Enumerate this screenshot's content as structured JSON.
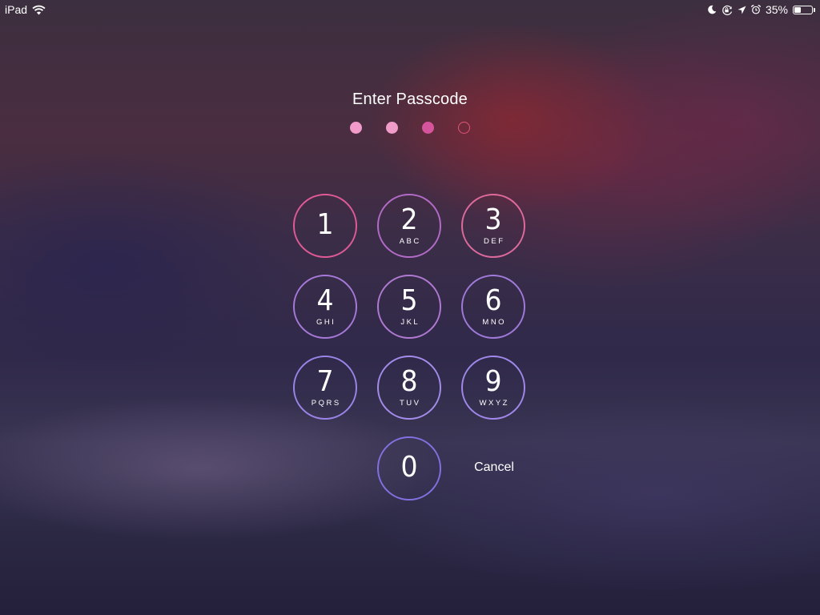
{
  "status_bar": {
    "device": "iPad",
    "battery_text": "35%",
    "battery_level": 0.35,
    "icons": [
      "wifi-icon",
      "moon-icon",
      "rotation-lock-icon",
      "location-arrow-icon",
      "alarm-icon",
      "battery-icon"
    ]
  },
  "passcode": {
    "title": "Enter Passcode",
    "digits_entered": 3,
    "digits_total": 4
  },
  "keypad": {
    "keys": [
      {
        "digit": "1",
        "letters": ""
      },
      {
        "digit": "2",
        "letters": "ABC"
      },
      {
        "digit": "3",
        "letters": "DEF"
      },
      {
        "digit": "4",
        "letters": "GHI"
      },
      {
        "digit": "5",
        "letters": "JKL"
      },
      {
        "digit": "6",
        "letters": "MNO"
      },
      {
        "digit": "7",
        "letters": "PQRS"
      },
      {
        "digit": "8",
        "letters": "TUV"
      },
      {
        "digit": "9",
        "letters": "WXYZ"
      },
      {
        "digit": "0",
        "letters": ""
      }
    ],
    "cancel_label": "Cancel"
  },
  "colors": {
    "dot_filled": [
      "#f29ac9",
      "#f09bc8",
      "#d6549c"
    ],
    "dot_outline": "#e0547c",
    "key_rings": [
      "#e05a96",
      "#b36bc8",
      "#de6a9c",
      "#a678d8",
      "#b07ad2",
      "#a07ad8",
      "#9a84e6",
      "#a48cea",
      "#a088ea",
      "#8070e0"
    ]
  }
}
